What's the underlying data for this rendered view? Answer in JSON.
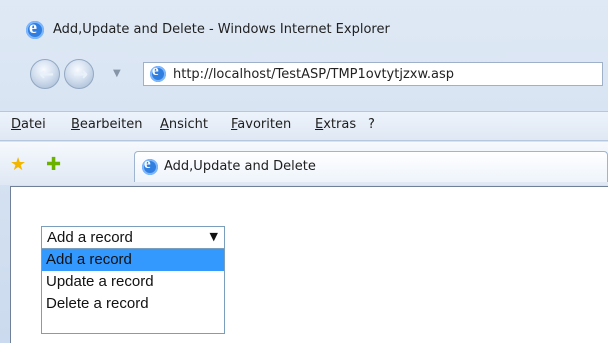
{
  "window": {
    "title": "Add,Update and Delete - Windows Internet Explorer"
  },
  "navigation": {
    "address": "http://localhost/TestASP/TMP1ovtytjzxw.asp"
  },
  "menu": {
    "items": [
      "Datei",
      "Bearbeiten",
      "Ansicht",
      "Favoriten",
      "Extras",
      "?"
    ]
  },
  "tab": {
    "title": "Add,Update and Delete"
  },
  "content": {
    "select": {
      "value": "Add a record",
      "options": [
        "Add a record",
        "Update a record",
        "Delete a record"
      ],
      "highlighted_index": 0
    }
  },
  "icons": {
    "browser": "ie-icon",
    "back": "back-arrow-icon",
    "forward": "forward-arrow-icon",
    "favorites": "star-icon",
    "add_favorites": "plus-star-icon"
  },
  "colors": {
    "highlight": "#3399ff",
    "chrome": "#dfe9f5"
  }
}
